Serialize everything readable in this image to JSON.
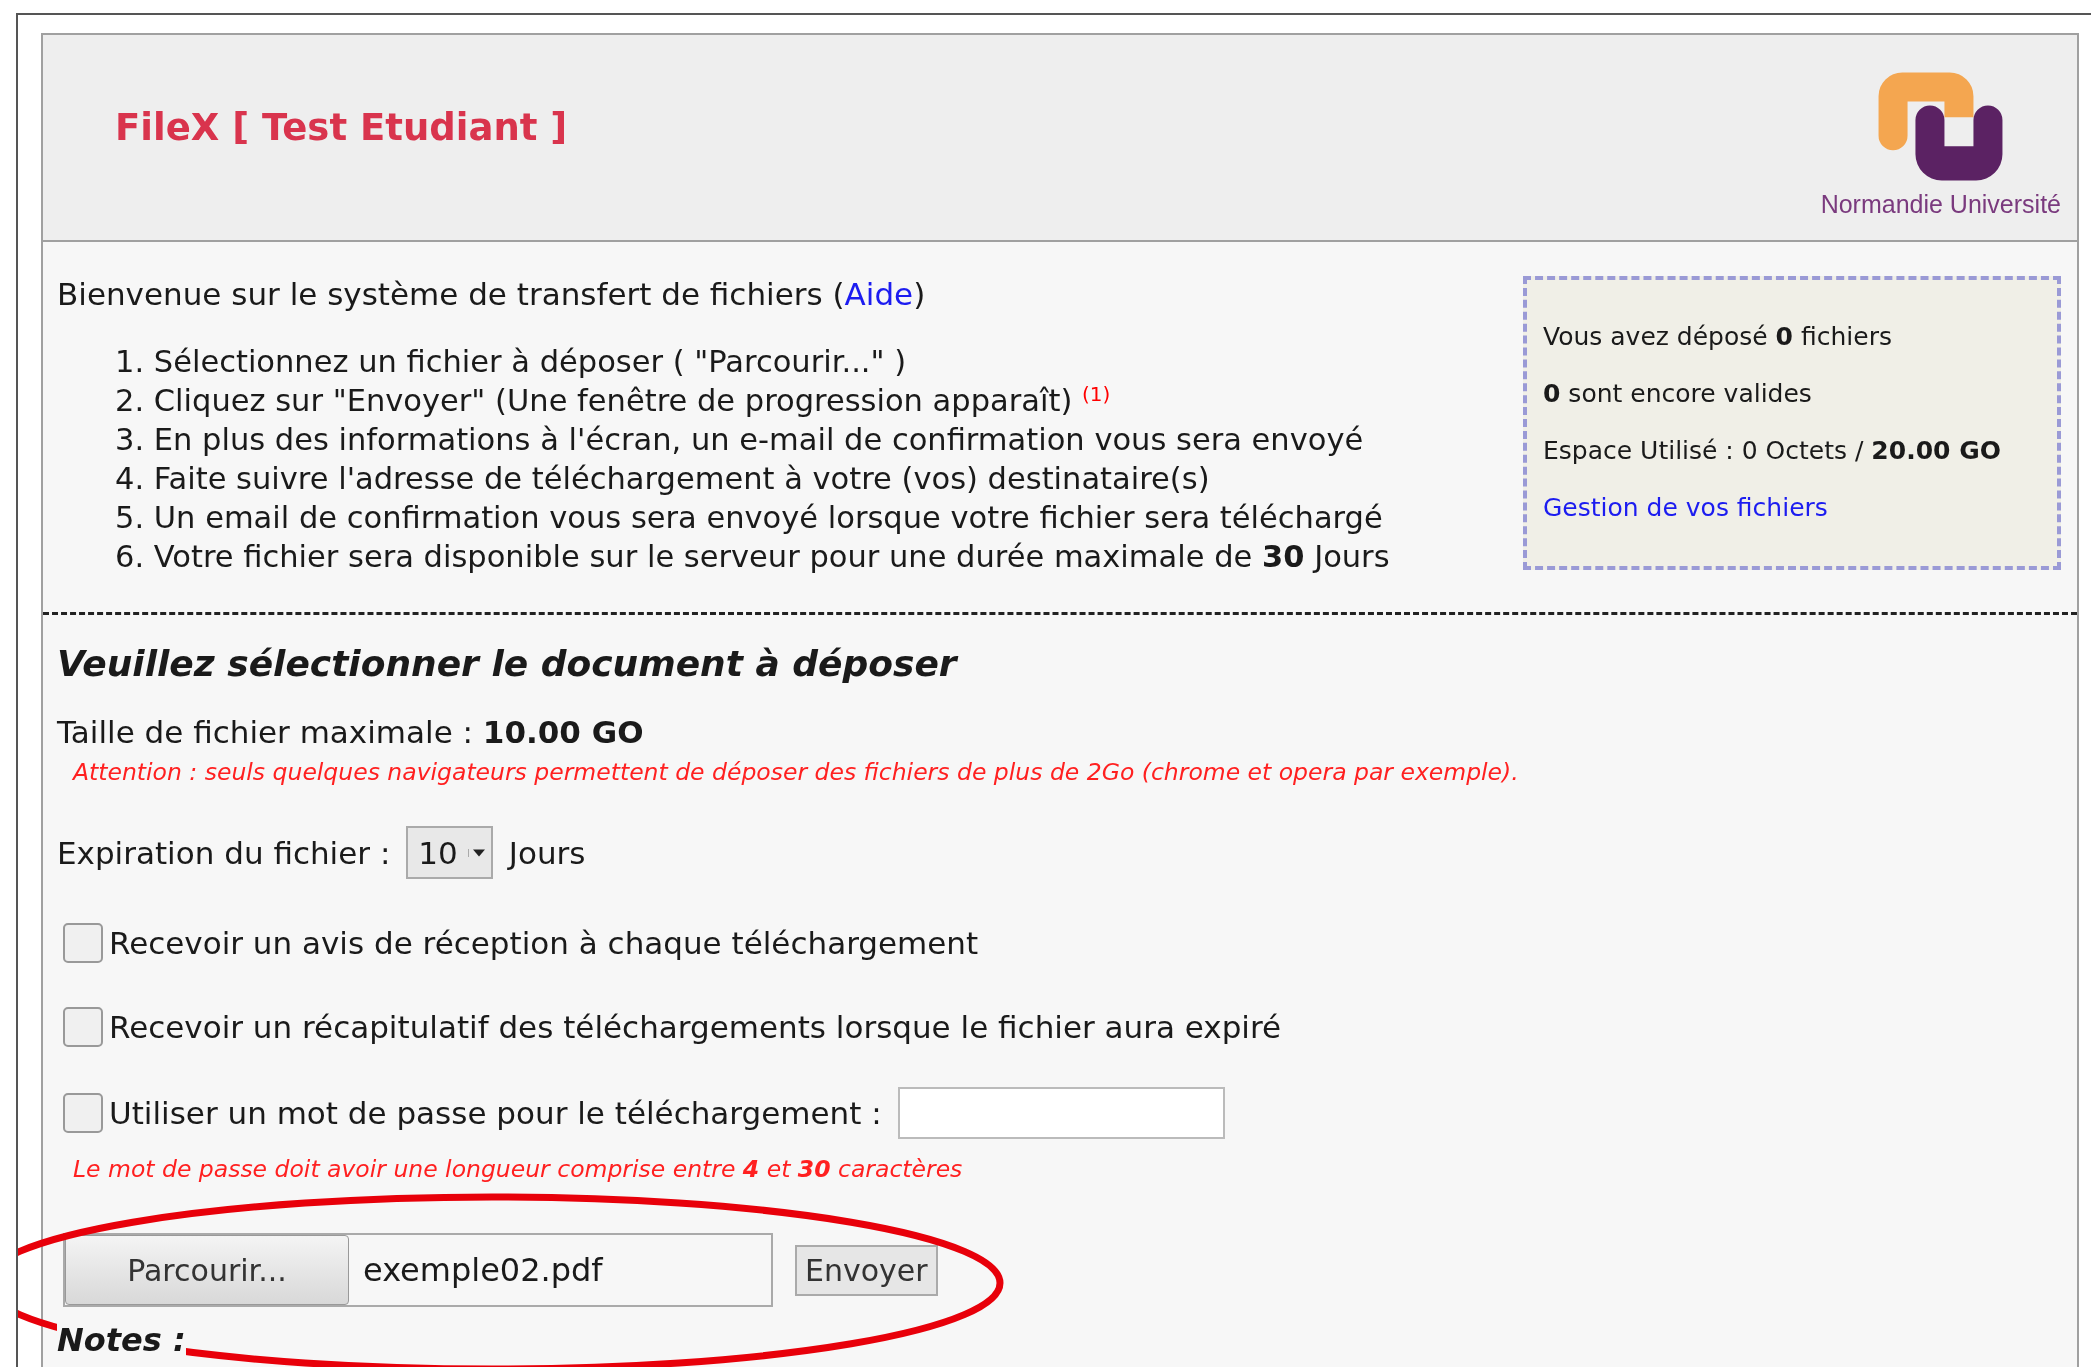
{
  "header": {
    "title": "FileX [ Test Etudiant ]",
    "logo_text": "Normandie Université"
  },
  "intro": {
    "text_before": "Bienvenue sur le système de transfert de fichiers (",
    "link": "Aide",
    "text_after": ")"
  },
  "steps": [
    "1. Sélectionnez un fichier à déposer ( \"Parcourir...\" )",
    "2. Cliquez sur \"Envoyer\" (Une fenêtre de progression apparaît) $^{(1)}$",
    "3. En plus des informations à l'écran, un e-mail de confirmation vous sera envoyé",
    "4. Faite suivre l'adresse de téléchargement à votre (vos) destinataire(s)",
    "5. Un email de confirmation vous sera envoyé lorsque votre fichier sera téléchargé",
    "6. Votre fichier sera disponible sur le serveur pour une durée maximale de **30** Jours"
  ],
  "stats": {
    "lines": [
      "Vous avez déposé **0** fichiers",
      "**0** sont encore valides",
      "Espace Utilisé : 0 Octets / **20.00 GO**"
    ],
    "link": "Gestion de vos fichiers"
  },
  "upload": {
    "heading": "Veuillez sélectionner le document à déposer",
    "max_size": "Taille de fichier maximale : **10.00 GO**",
    "warning": "Attention : seuls quelques navigateurs permettent de déposer des fichiers de plus de 2Go (chrome et opera par exemple).",
    "expiration_label": "Expiration du fichier :",
    "expiration_value": "10",
    "expiration_unit": "Jours",
    "options": [
      {
        "kind": "plain",
        "label": "Recevoir un avis de réception à chaque téléchargement",
        "checked": false
      },
      {
        "kind": "plain",
        "label": "Recevoir un récapitulatif des téléchargements lorsque le fichier aura expiré",
        "checked": false
      },
      {
        "kind": "password",
        "label": "Utiliser un mot de passe pour le téléchargement :",
        "checked": false
      }
    ],
    "password_hint": "Le mot de passe doit avoir une longueur comprise entre **4** et **30** caractères",
    "browse_button": "Parcourir...",
    "file_name": "exemple02.pdf",
    "submit_button": "Envoyer",
    "notes_heading": "Notes :"
  }
}
